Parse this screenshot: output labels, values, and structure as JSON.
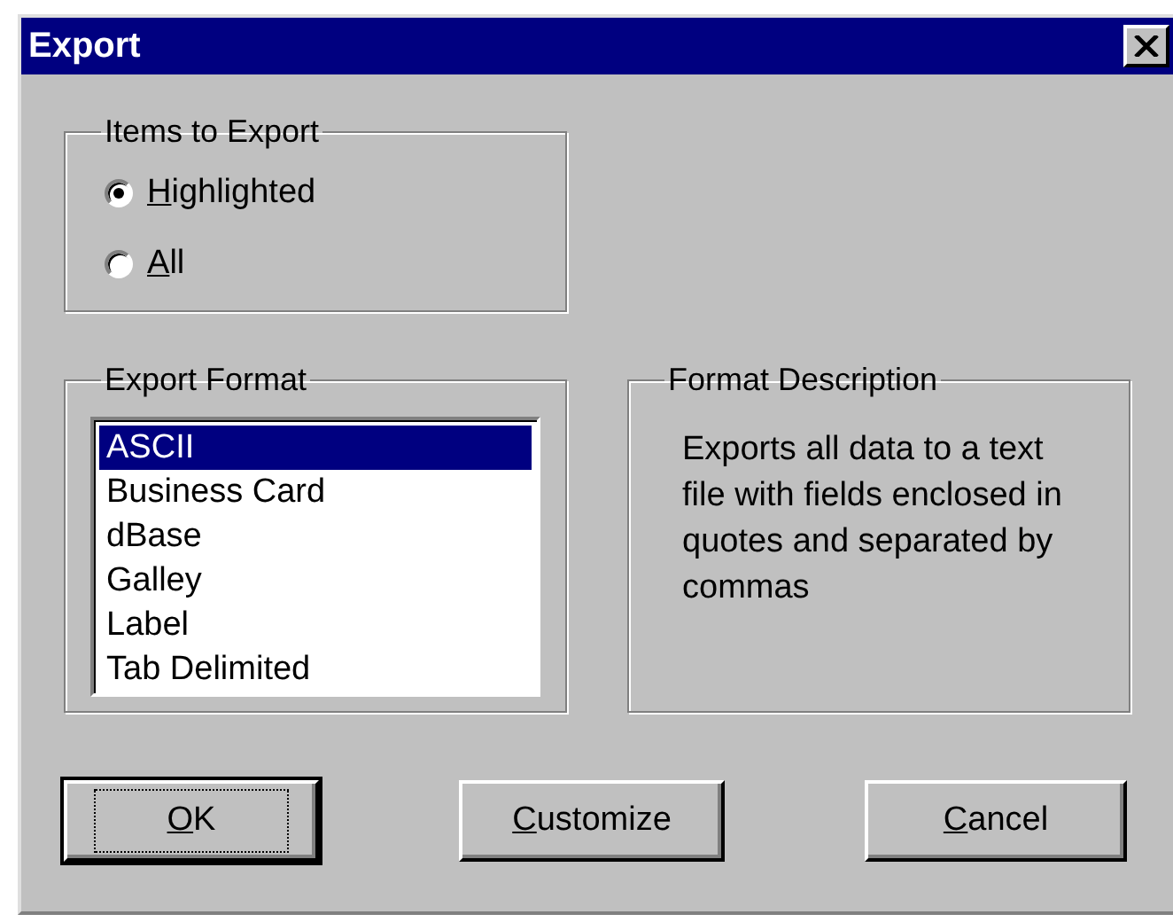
{
  "window": {
    "title": "Export"
  },
  "items_group": {
    "title": "Items to Export",
    "options": [
      {
        "label": "Highlighted",
        "selected": true,
        "mnemonic_first": true
      },
      {
        "label": "All",
        "selected": false,
        "mnemonic_first": true
      }
    ]
  },
  "format_group": {
    "title": "Export Format",
    "items": [
      {
        "label": "ASCII",
        "selected": true
      },
      {
        "label": "Business Card",
        "selected": false
      },
      {
        "label": "dBase",
        "selected": false
      },
      {
        "label": "Galley",
        "selected": false
      },
      {
        "label": "Label",
        "selected": false
      },
      {
        "label": "Tab Delimited",
        "selected": false
      }
    ]
  },
  "description_group": {
    "title": "Format Description",
    "text": "Exports all data to a text file with fields enclosed in quotes and separated by commas"
  },
  "buttons": [
    {
      "label": "OK",
      "default": true,
      "mnemonic_first": true
    },
    {
      "label": "Customize",
      "default": false,
      "mnemonic_first": true
    },
    {
      "label": "Cancel",
      "default": false,
      "mnemonic_first": true
    }
  ]
}
